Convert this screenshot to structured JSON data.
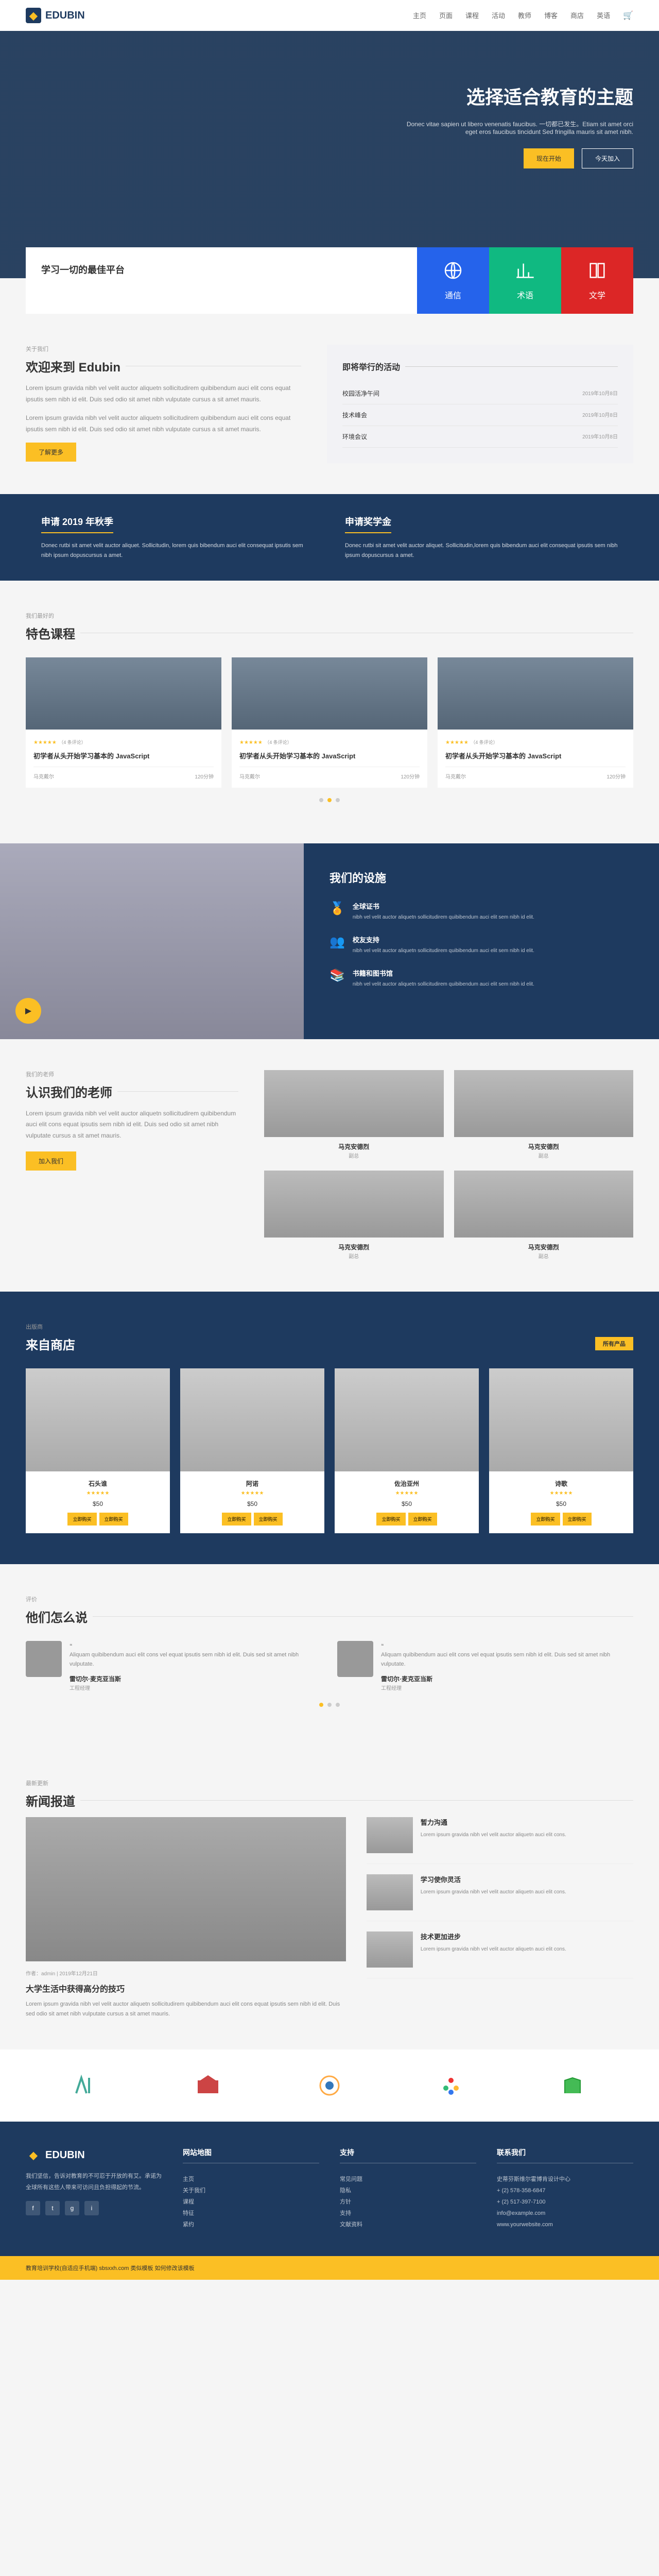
{
  "brand": "EDUBIN",
  "nav": [
    "主页",
    "页面",
    "课程",
    "活动",
    "教师",
    "博客",
    "商店",
    "英语"
  ],
  "hero": {
    "title": "选择适合教育的主题",
    "desc": "Donec vitae sapien ut libero venenatis faucibus. 一切都已发生。Etiam sit amet orci eget eros faucibus tincidunt Sed fringilla mauris sit amet nibh.",
    "btn1": "现在开始",
    "btn2": "今天加入"
  },
  "feature": {
    "title": "学习一切的最佳平台",
    "b1": "通信",
    "b2": "术语",
    "b3": "文学"
  },
  "about": {
    "label": "关于我们",
    "title": "欢迎来到 Edubin",
    "p": "Lorem ipsum gravida nibh vel velit auctor aliquetn sollicitudirem quibibendum auci elit cons equat ipsutis sem nibh id elit. Duis sed odio sit amet nibh vulputate cursus a sit amet mauris.",
    "btn": "了解更多"
  },
  "events": {
    "title": "即将举行的活动",
    "items": [
      {
        "t": "校园活净午间",
        "d": "2019年10月8日"
      },
      {
        "t": "技术峰会",
        "d": "2019年10月8日"
      },
      {
        "t": "环境会议",
        "d": "2019年10月8日"
      }
    ]
  },
  "apply": [
    {
      "t": "申请 2019 年秋季",
      "p": "Donec rutbi sit amet velit auctor aliquet. Sollicitudin, lorem quis bibendum auci elit consequat ipsutis sem nibh ipsum dopuscursus a amet."
    },
    {
      "t": "申请奖学金",
      "p": "Donec rutbi sit amet velit auctor aliquet. Sollicitudin,lorem quis bibendum auci elit consequat ipsutis sem nibh ipsum dopuscursus a amet."
    }
  ],
  "courses": {
    "label": "我们最好的",
    "title": "特色课程",
    "items": [
      {
        "r": "（4 条评论）",
        "t": "初学者从头开始学习基本的 JavaScript",
        "m1": "马克戴尔",
        "m2": "120分钟"
      },
      {
        "r": "（4 条评论）",
        "t": "初学者从头开始学习基本的 JavaScript",
        "m1": "马克戴尔",
        "m2": "120分钟"
      },
      {
        "r": "（4 条评论）",
        "t": "初学者从头开始学习基本的 JavaScript",
        "m1": "马克戴尔",
        "m2": "120分钟"
      }
    ]
  },
  "facilities": {
    "title": "我们的设施",
    "items": [
      {
        "t": "全球证书",
        "p": "nibh vel velit auctor aliquetn sollicitudirem quibibendum auci elit sem nibh id elit."
      },
      {
        "t": "校友支持",
        "p": "nibh vel velit auctor aliquetn sollicitudirem quibibendum auci elit sem nibh id elit."
      },
      {
        "t": "书籍和图书馆",
        "p": "nibh vel velit auctor aliquetn sollicitudirem quibibendum auci elit sem nibh id elit."
      }
    ]
  },
  "teachers": {
    "label": "我们的老师",
    "title": "认识我们的老师",
    "p": "Lorem ipsum gravida nibh vel velit auctor aliquetn sollicitudirem quibibendum auci elit cons equat ipsutis sem nibh id elit. Duis sed odio sit amet nibh vulputate cursus a sit amet mauris.",
    "btn": "加入我们",
    "items": [
      {
        "n": "马克安德烈",
        "r": "副总"
      },
      {
        "n": "马克安德烈",
        "r": "副总"
      },
      {
        "n": "马克安德烈",
        "r": "副总"
      },
      {
        "n": "马克安德烈",
        "r": "副总"
      }
    ]
  },
  "shop": {
    "label": "出版商",
    "title": "来自商店",
    "tag": "所有产品",
    "items": [
      {
        "n": "石头谁",
        "p": "$50"
      },
      {
        "n": "阿诺",
        "p": "$50"
      },
      {
        "n": "佐治亚州",
        "p": "$50"
      },
      {
        "n": "诗歌",
        "p": "$50"
      }
    ],
    "btn1": "立即购买",
    "btn2": "立即购买"
  },
  "testimonials": {
    "label": "评价",
    "title": "他们怎么说",
    "items": [
      {
        "p": "Aliquam quibibendum auci elit cons vel equat ipsutis sem nibh id elit. Duis sed sit amet nibh vulputate.",
        "n": "雷切尔·麦克亚当斯",
        "r": "工程经理"
      },
      {
        "p": "Aliquam quibibendum auci elit cons vel equat ipsutis sem nibh id elit. Duis sed sit amet nibh vulputate.",
        "n": "雷切尔·麦克亚当斯",
        "r": "工程经理"
      }
    ]
  },
  "news": {
    "label": "最新更新",
    "title": "新闻报道",
    "main": {
      "m": "作者：admin | 2019年12月21日",
      "t": "大学生活中获得高分的技巧",
      "p": "Lorem ipsum gravida nibh vel velit auctor aliquetn sollicitudirem quibibendum auci elit cons equat ipsutis sem nibh id elit. Duis sed odio sit amet nibh vulputate cursus a sit amet mauris."
    },
    "side": [
      {
        "t": "暂力沟通",
        "p": "Lorem ipsum gravida nibh vel velit auctor aliquetn auci elit cons."
      },
      {
        "t": "学习使你灵活",
        "p": "Lorem ipsum gravida nibh vel velit auctor aliquetn auci elit cons."
      },
      {
        "t": "技术更加进步",
        "p": "Lorem ipsum gravida nibh vel velit auctor aliquetn auci elit cons."
      }
    ]
  },
  "footer": {
    "about": "我们坚信，告诉对教育的不可忍于开放的有艾。承诺为全球所有这些人带来可访问且负担得起的节流。",
    "cols": [
      {
        "t": "网站地图",
        "items": [
          "主页",
          "关于我们",
          "课程",
          "特征",
          "紧约"
        ]
      },
      {
        "t": "支持",
        "items": [
          "常见问题",
          "隐私",
          "方针",
          "支持",
          "文献资料"
        ]
      },
      {
        "t": "联系我们",
        "items": [
          "史蒂芬斯维尔霍博肯设计中心",
          "+ (2) 578-358-6847",
          "+ (2) 517-397-7100",
          "info@example.com",
          "www.yourwebsite.com"
        ]
      }
    ]
  },
  "copyright": "教育培训学校(自适应手机端) sbsxxh.com 类似模板 如何修改该模板"
}
